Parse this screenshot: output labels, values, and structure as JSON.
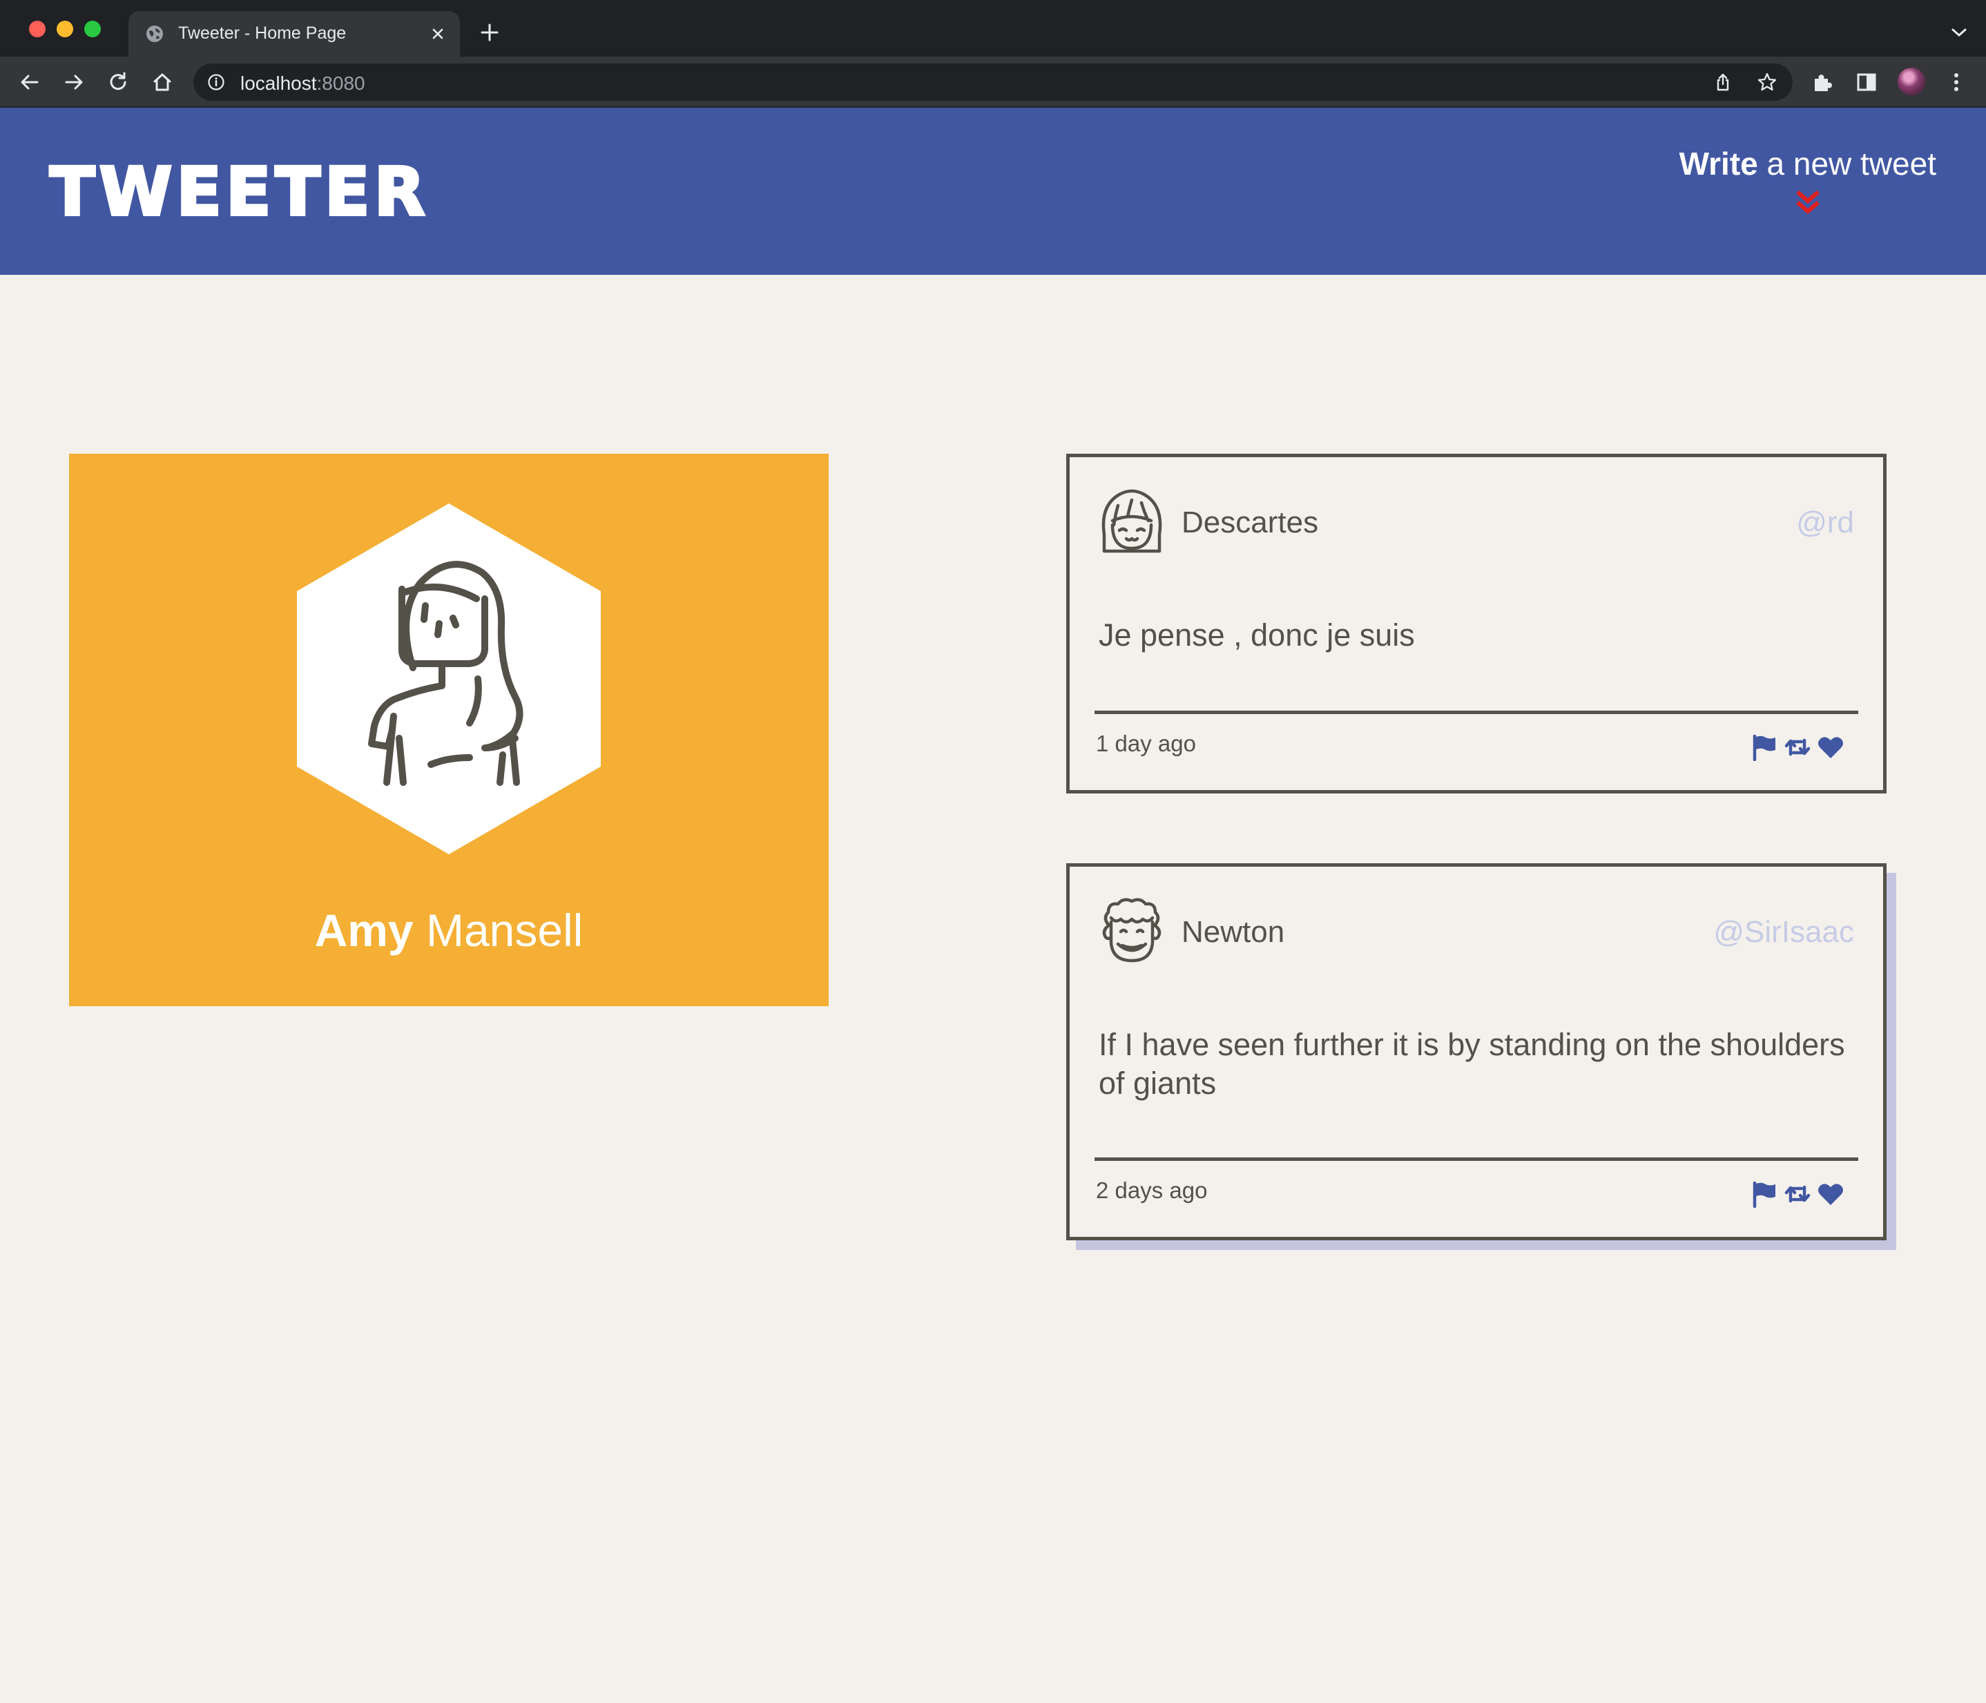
{
  "browser": {
    "tab_title": "Tweeter - Home Page",
    "url_host": "localhost",
    "url_port": ":8080"
  },
  "nav": {
    "logo": "TWEETER",
    "compose_strong": "Write",
    "compose_rest": " a new tweet"
  },
  "profile": {
    "first_name": "Amy",
    "last_name": "Mansell",
    "background_color": "#f4af34"
  },
  "tweets": [
    {
      "name": "Descartes",
      "handle": "@rd",
      "content": "Je pense , donc je suis",
      "time": "1 day ago"
    },
    {
      "name": "Newton",
      "handle": "@SirIsaac",
      "content": "If I have seen further it is by standing on the shoulders of giants",
      "time": "2 days ago"
    }
  ],
  "colors": {
    "nav": "#4157a2",
    "accent": "#e0201d",
    "page_bg": "#f4f1ec",
    "action_icons": "#4157a2"
  },
  "icons": [
    "flag-icon",
    "retweet-icon",
    "heart-icon",
    "chevron-double-down-icon"
  ]
}
